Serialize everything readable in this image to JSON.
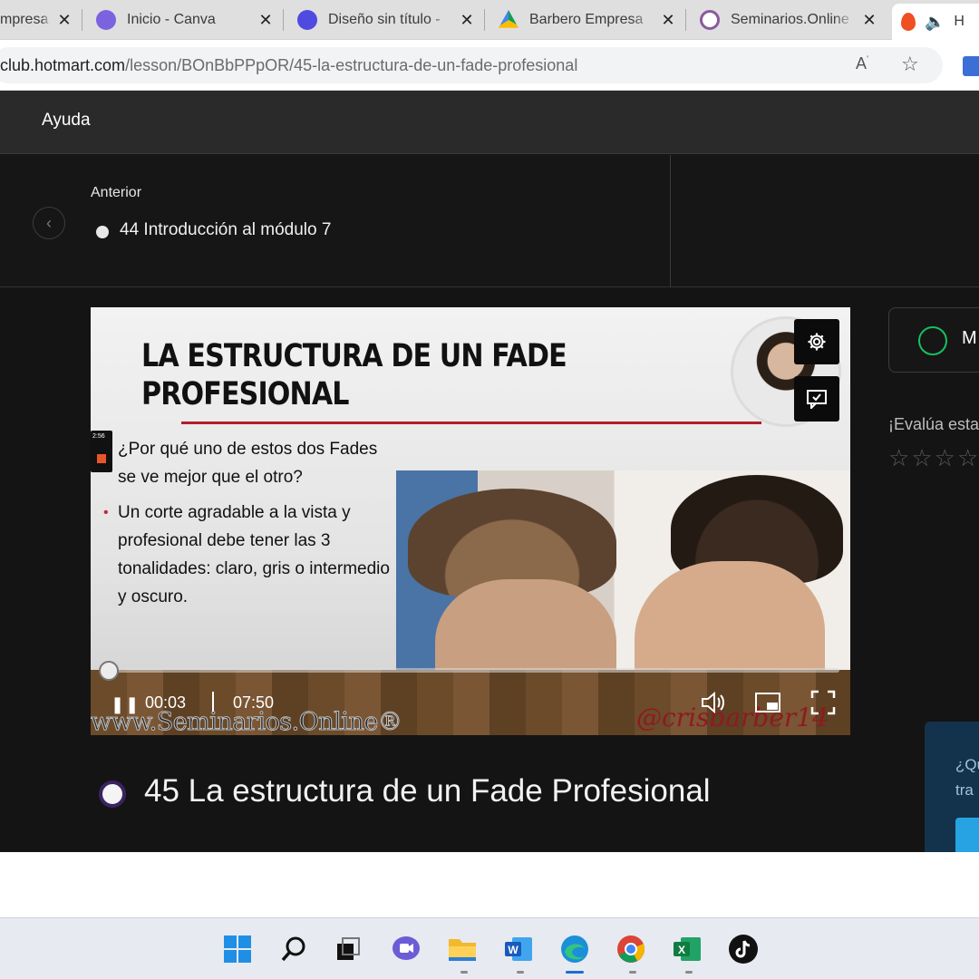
{
  "browser": {
    "tabs": [
      {
        "title": "mpresa",
        "icon": "generic-site-icon"
      },
      {
        "title": "Inicio - Canva",
        "icon": "canva-icon"
      },
      {
        "title": "Diseño sin título -",
        "icon": "canva-icon"
      },
      {
        "title": "Barbero Empresa",
        "icon": "google-drive-icon"
      },
      {
        "title": "Seminarios.Online",
        "icon": "seminarios-icon"
      },
      {
        "title": "H",
        "icon": "hotmart-icon"
      }
    ],
    "url_main": "club.hotmart.com",
    "url_path": "/lesson/BOnBbPPpOR/45-la-estructura-de-un-fade-profesional"
  },
  "header": {
    "help_label": "Ayuda"
  },
  "previous": {
    "caption": "Anterior",
    "title": "44 Introducción al módulo 7"
  },
  "video": {
    "slide_title_line1": "LA ESTRUCTURA DE UN FADE",
    "slide_title_line2": "PROFESIONAL",
    "bullet_1_line1": "¿Por qué uno de estos dos Fades",
    "bullet_1_line2": "se ve mejor que el otro?",
    "bullet_2_line1": "Un corte agradable a la vista y",
    "bullet_2_line2": "profesional debe tener las 3",
    "bullet_2_line3": "tonalidades: claro, gris o intermedio",
    "bullet_2_line4": "y oscuro.",
    "watermark_left": "www.Seminarios.Online®",
    "watermark_right": "@crisbarber14",
    "mini_badge_time": "2:56",
    "current_time": "00:03",
    "duration": "07:50",
    "progress_fraction": 0.007
  },
  "lesson": {
    "title": "45 La estructura de un Fade Profesional"
  },
  "sidebar": {
    "complete_label": "M",
    "rate_label": "¡Evalúa esta",
    "star_count": 4,
    "help_text_line1": "¿Qu",
    "help_text_line2": "tra"
  },
  "taskbar": {
    "apps": [
      "windows-start-icon",
      "search-icon",
      "task-view-icon",
      "teams-chat-icon",
      "file-explorer-icon",
      "word-icon",
      "edge-icon",
      "chrome-icon",
      "excel-icon",
      "tiktok-icon"
    ]
  }
}
